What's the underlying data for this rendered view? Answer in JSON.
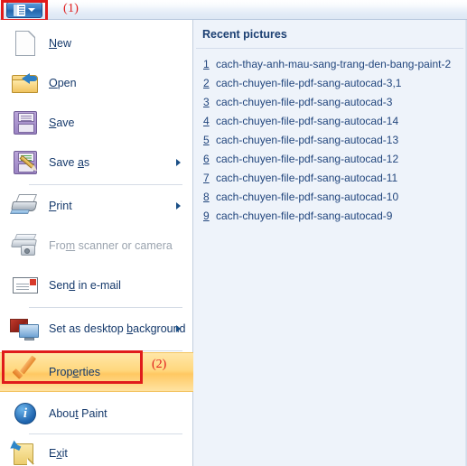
{
  "titlebar": {
    "paint_button_icon": "paint-menu-icon",
    "dropdown_icon": "chevron-down-icon",
    "marker_1": "(1)",
    "marker_2": "(2)",
    "highlight_color": "#e01b1b"
  },
  "menu": {
    "items": [
      {
        "label": "New",
        "accel_pre": "",
        "accel": "N",
        "accel_post": "ew",
        "icon": "new-document-icon",
        "submenu": false,
        "disabled": false,
        "highlighted": false,
        "sep_above": false
      },
      {
        "label": "Open",
        "accel_pre": "",
        "accel": "O",
        "accel_post": "pen",
        "icon": "open-folder-icon",
        "submenu": false,
        "disabled": false,
        "highlighted": false,
        "sep_above": false
      },
      {
        "label": "Save",
        "accel_pre": "",
        "accel": "S",
        "accel_post": "ave",
        "icon": "save-floppy-icon",
        "submenu": false,
        "disabled": false,
        "highlighted": false,
        "sep_above": false
      },
      {
        "label": "Save as",
        "accel_pre": "Save ",
        "accel": "a",
        "accel_post": "s",
        "icon": "save-as-floppy-icon",
        "submenu": true,
        "disabled": false,
        "highlighted": false,
        "sep_above": false
      },
      {
        "label": "Print",
        "accel_pre": "",
        "accel": "P",
        "accel_post": "rint",
        "icon": "printer-icon",
        "submenu": true,
        "disabled": false,
        "highlighted": false,
        "sep_above": true
      },
      {
        "label": "From scanner or camera",
        "accel_pre": "Fro",
        "accel": "m",
        "accel_post": " scanner or camera",
        "icon": "scanner-camera-icon",
        "submenu": false,
        "disabled": true,
        "highlighted": false,
        "sep_above": false
      },
      {
        "label": "Send in e-mail",
        "accel_pre": "Sen",
        "accel": "d",
        "accel_post": " in e-mail",
        "icon": "envelope-icon",
        "submenu": false,
        "disabled": false,
        "highlighted": false,
        "sep_above": false
      },
      {
        "label": "Set as desktop background",
        "accel_pre": "Set as desktop ",
        "accel": "b",
        "accel_post": "ackground",
        "icon": "desktop-background-icon",
        "submenu": true,
        "disabled": false,
        "highlighted": false,
        "sep_above": true
      },
      {
        "label": "Properties",
        "accel_pre": "Prop",
        "accel": "e",
        "accel_post": "rties",
        "icon": "orange-check-icon",
        "submenu": false,
        "disabled": false,
        "highlighted": true,
        "sep_above": true
      },
      {
        "label": "About Paint",
        "accel_pre": "Abou",
        "accel": "t",
        "accel_post": " Paint",
        "icon": "info-circle-icon",
        "submenu": false,
        "disabled": false,
        "highlighted": false,
        "sep_above": false
      },
      {
        "label": "Exit",
        "accel_pre": "E",
        "accel": "x",
        "accel_post": "it",
        "icon": "exit-icon",
        "submenu": false,
        "disabled": false,
        "highlighted": false,
        "sep_above": true
      }
    ]
  },
  "recent": {
    "title": "Recent pictures",
    "items": [
      {
        "num": "1",
        "name": "cach-thay-anh-mau-sang-trang-den-bang-paint-2"
      },
      {
        "num": "2",
        "name": "cach-chuyen-file-pdf-sang-autocad-3,1"
      },
      {
        "num": "3",
        "name": "cach-chuyen-file-pdf-sang-autocad-3"
      },
      {
        "num": "4",
        "name": "cach-chuyen-file-pdf-sang-autocad-14"
      },
      {
        "num": "5",
        "name": "cach-chuyen-file-pdf-sang-autocad-13"
      },
      {
        "num": "6",
        "name": "cach-chuyen-file-pdf-sang-autocad-12"
      },
      {
        "num": "7",
        "name": "cach-chuyen-file-pdf-sang-autocad-11"
      },
      {
        "num": "8",
        "name": "cach-chuyen-file-pdf-sang-autocad-10"
      },
      {
        "num": "9",
        "name": "cach-chuyen-file-pdf-sang-autocad-9"
      }
    ]
  }
}
